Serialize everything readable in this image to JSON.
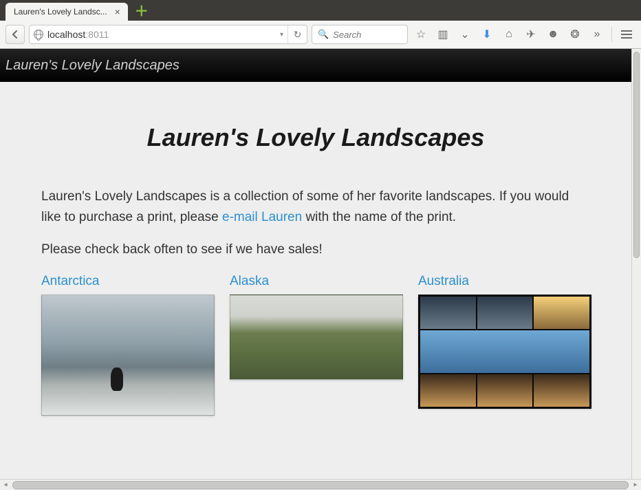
{
  "browser": {
    "tab_title": "Lauren's Lovely Landsc...",
    "url_host": "localhost",
    "url_port": ":8011",
    "search_placeholder": "Search"
  },
  "header": {
    "brand": "Lauren's Lovely Landscapes"
  },
  "page": {
    "heading": "Lauren's Lovely Landscapes",
    "intro_1a": "Lauren's Lovely Landscapes is a collection of some of her favorite landscapes. If you would like to purchase a print, please ",
    "intro_link": "e-mail Lauren",
    "intro_1b": " with the name of the print.",
    "intro_2": "Please check back often to see if we have sales!"
  },
  "gallery": [
    {
      "title": "Antarctica"
    },
    {
      "title": "Alaska"
    },
    {
      "title": "Australia"
    }
  ]
}
